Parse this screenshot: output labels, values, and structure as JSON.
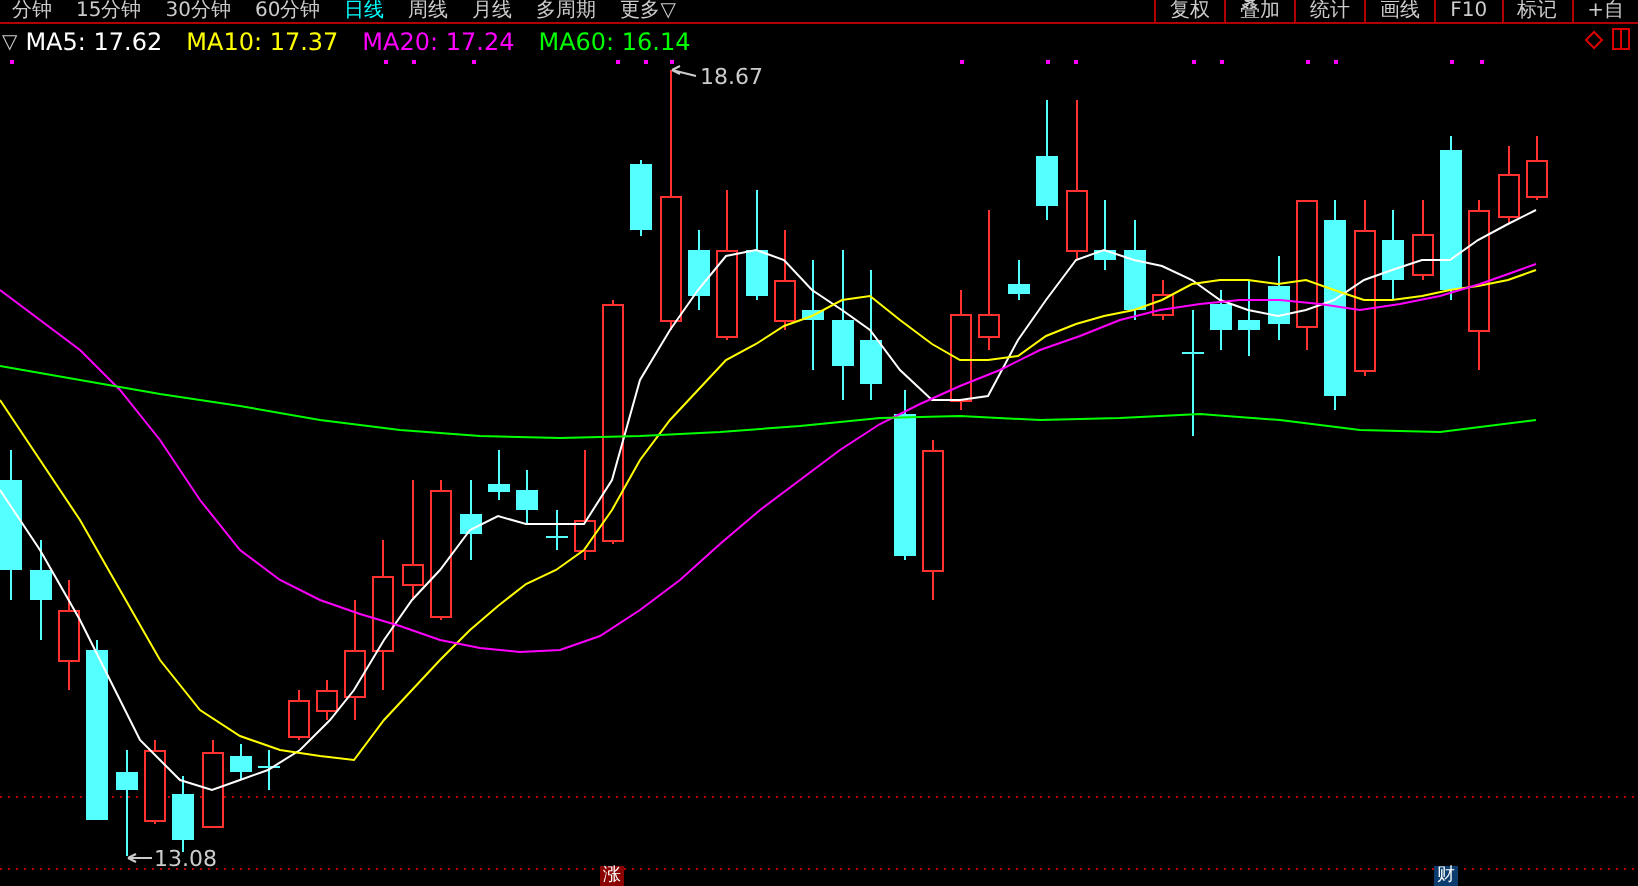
{
  "toolbar": {
    "periods": [
      {
        "label": "分钟",
        "selected": false
      },
      {
        "label": "15分钟",
        "selected": false
      },
      {
        "label": "30分钟",
        "selected": false
      },
      {
        "label": "60分钟",
        "selected": false
      },
      {
        "label": "日线",
        "selected": true
      },
      {
        "label": "周线",
        "selected": false
      },
      {
        "label": "月线",
        "selected": false
      },
      {
        "label": "多周期",
        "selected": false
      },
      {
        "label": "更多▽",
        "selected": false
      }
    ],
    "tools": [
      "复权",
      "叠加",
      "统计",
      "画线",
      "F10",
      "标记",
      "+自"
    ]
  },
  "legend": {
    "toggle": "▽",
    "averages": [
      {
        "label": "MA5: 17.62",
        "color": "#ffffff"
      },
      {
        "label": "MA10: 17.37",
        "color": "#ffff00"
      },
      {
        "label": "MA20: 17.24",
        "color": "#ff00ff"
      },
      {
        "label": "MA60: 16.14",
        "color": "#00ff00"
      }
    ]
  },
  "chart": {
    "high_label": "18.67",
    "low_label": "13.08",
    "events": [
      {
        "label": "涨",
        "color": "#8b0000"
      },
      {
        "label": "财",
        "color": "#0a3d6e"
      }
    ]
  }
}
